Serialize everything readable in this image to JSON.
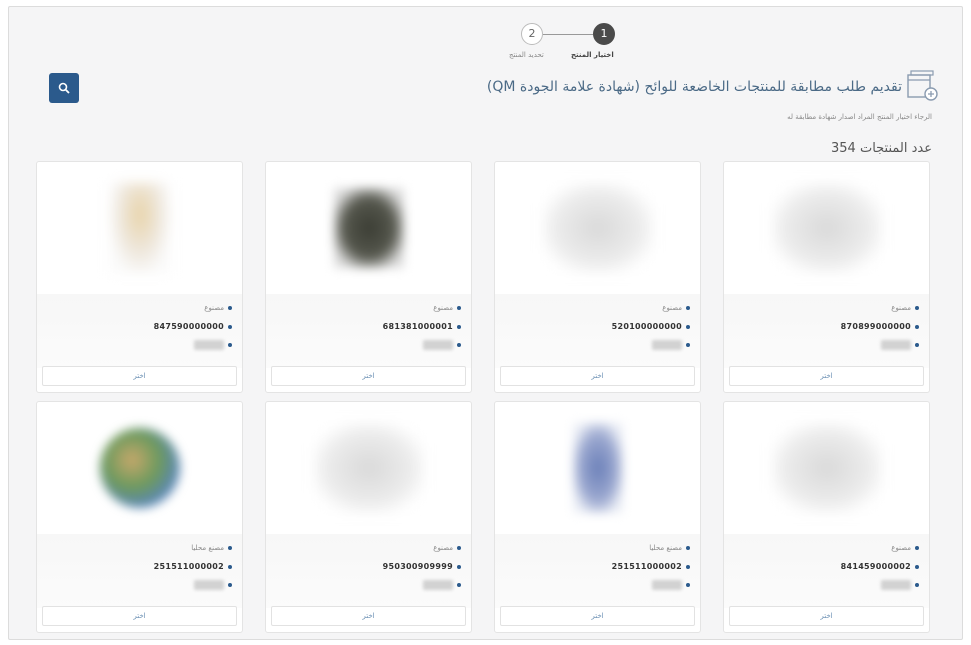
{
  "stepper": {
    "steps": [
      {
        "number": "2",
        "label": "تحديد المنتج"
      },
      {
        "number": "1",
        "label": "اختيار المنتج"
      }
    ]
  },
  "header": {
    "title": "تقديم طلب مطابقة للمنتجات الخاضعة للوائح (شهادة علامة الجودة QM)",
    "subtitle": "الرجاء اختيار المنتج المراد اصدار شهادة مطابقة له",
    "search_icon": "search-icon",
    "title_icon": "add-document-icon"
  },
  "products_count": "عدد المنتجات 354",
  "colors": {
    "primary": "#2b5a8c",
    "link": "#6a8fb3"
  },
  "products": [
    {
      "type": "مصنوع",
      "code": "870899000000",
      "button": "اختر",
      "image": "grey"
    },
    {
      "type": "مصنوع",
      "code": "520100000000",
      "button": "اختر",
      "image": "grey"
    },
    {
      "type": "مصنوع",
      "code": "681381000001",
      "button": "اختر",
      "image": "dark"
    },
    {
      "type": "مصنوع",
      "code": "847590000000",
      "button": "اختر",
      "image": "beige"
    },
    {
      "type": "مصنوع",
      "code": "841459000002",
      "button": "اختر",
      "image": "grey"
    },
    {
      "type": "مصنع محليا",
      "code": "251511000002",
      "button": "اختر",
      "image": "blue"
    },
    {
      "type": "مصنوع",
      "code": "950300909999",
      "button": "اختر",
      "image": "grey"
    },
    {
      "type": "مصنع محليا",
      "code": "251511000002",
      "button": "اختر",
      "image": "globe"
    }
  ]
}
